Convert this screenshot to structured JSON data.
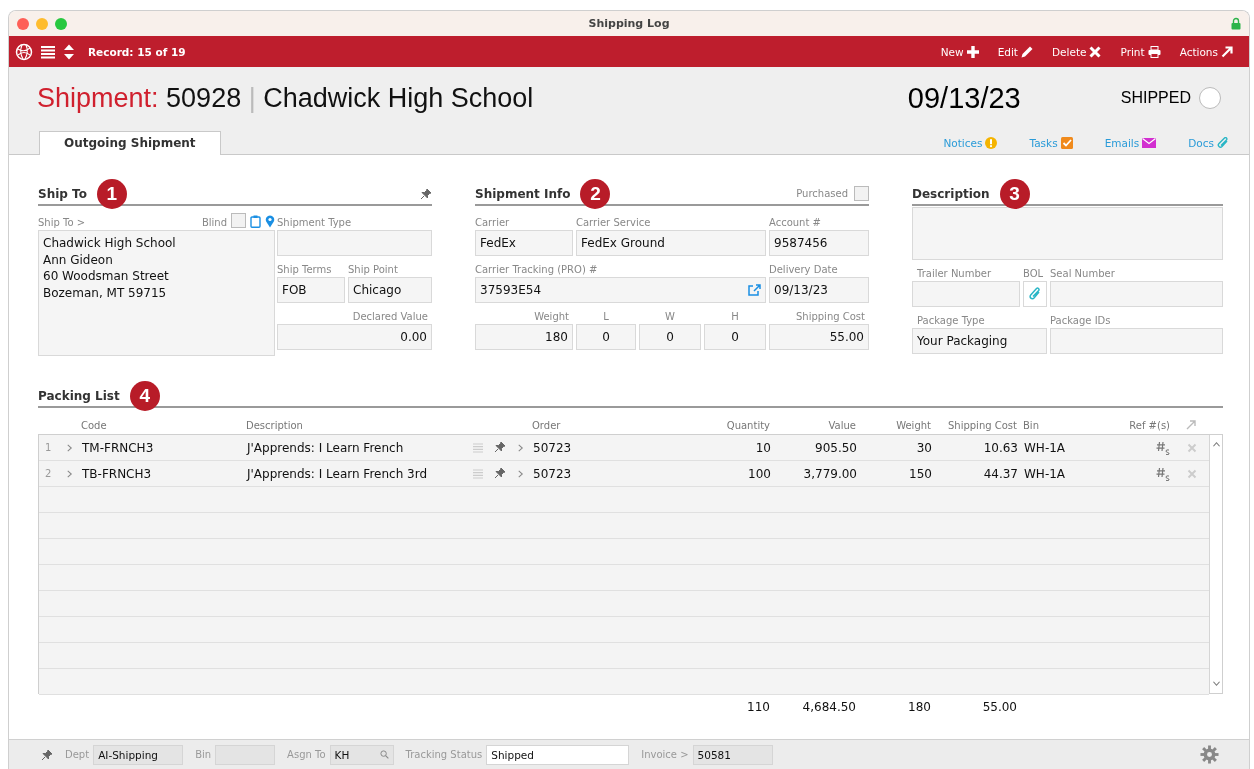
{
  "window": {
    "title": "Shipping Log"
  },
  "toolbar": {
    "record": "Record: 15 of 19",
    "actions": [
      {
        "label": "New",
        "kind": "new"
      },
      {
        "label": "Edit",
        "kind": "edit"
      },
      {
        "label": "Delete",
        "kind": "delete"
      },
      {
        "label": "Print",
        "kind": "print"
      },
      {
        "label": "Actions",
        "kind": "actions"
      }
    ]
  },
  "header": {
    "prefix": "Shipment:",
    "number": "50928",
    "separator": "|",
    "name": "Chadwick High School",
    "date": "09/13/23",
    "status": {
      "label": "SHIPPED",
      "checked": false
    }
  },
  "tabs": [
    {
      "label": "Outgoing Shipment",
      "selected": true
    }
  ],
  "links": [
    {
      "label": "Notices",
      "kind": "notices"
    },
    {
      "label": "Tasks",
      "kind": "tasks"
    },
    {
      "label": "Emails",
      "kind": "emails"
    },
    {
      "label": "Docs",
      "kind": "docs"
    }
  ],
  "ship_to": {
    "title": "Ship To",
    "badge": "1",
    "link": "Ship To >",
    "blind": {
      "label": "Blind",
      "checked": false
    },
    "address_lines": [
      "Chadwick High School",
      "Ann Gideon",
      "60 Woodsman Street",
      "Bozeman, MT 59715"
    ],
    "shipment_type": {
      "label": "Shipment Type"
    },
    "ship_terms": {
      "label": "Ship Terms",
      "value": "FOB"
    },
    "ship_point": {
      "label": "Ship Point",
      "value": "Chicago"
    },
    "declared_value": {
      "label": "Declared Value",
      "value": "0.00"
    }
  },
  "shipment_info": {
    "title": "Shipment Info",
    "badge": "2",
    "purchased": {
      "label": "Purchased",
      "checked": false
    },
    "carrier": {
      "label": "Carrier",
      "value": "FedEx"
    },
    "carrier_service": {
      "label": "Carrier Service",
      "value": "FedEx Ground"
    },
    "account": {
      "label": "Account #",
      "value": "9587456"
    },
    "tracking": {
      "label": "Carrier Tracking (PRO) #",
      "value": "37593E54"
    },
    "delivery_date": {
      "label": "Delivery Date",
      "value": "09/13/23"
    },
    "weight": {
      "label": "Weight",
      "value": "180"
    },
    "length": {
      "label": "L",
      "value": "0"
    },
    "width": {
      "label": "W",
      "value": "0"
    },
    "height": {
      "label": "H",
      "value": "0"
    },
    "shipping_cost": {
      "label": "Shipping Cost",
      "value": "55.00"
    }
  },
  "description": {
    "title": "Description",
    "badge": "3",
    "trailer_number": {
      "label": "Trailer Number"
    },
    "bol": {
      "label": "BOL"
    },
    "seal_number": {
      "label": "Seal Number"
    },
    "package_type": {
      "label": "Package Type",
      "value": "Your Packaging"
    },
    "package_ids": {
      "label": "Package IDs"
    }
  },
  "packing_list": {
    "title": "Packing List",
    "badge": "4",
    "columns": [
      {
        "label": "Code"
      },
      {
        "label": "Description"
      },
      {
        "label": "Order"
      },
      {
        "label": "Quantity"
      },
      {
        "label": "Value"
      },
      {
        "label": "Weight"
      },
      {
        "label": "Shipping Cost"
      },
      {
        "label": "Bin"
      },
      {
        "label": "Ref #(s)"
      }
    ],
    "rows": [
      {
        "number": "1",
        "code": "TM-FRNCH3",
        "description": "J'Apprends: I Learn French",
        "order": "50723",
        "quantity": "10",
        "value": "905.50",
        "weight": "30",
        "shipping_cost": "10.63",
        "bin": "WH-1A"
      },
      {
        "number": "2",
        "code": "TB-FRNCH3",
        "description": "J'Apprends: I Learn French 3rd",
        "order": "50723",
        "quantity": "100",
        "value": "3,779.00",
        "weight": "150",
        "shipping_cost": "44.37",
        "bin": "WH-1A"
      }
    ],
    "totals": {
      "quantity": "110",
      "value": "4,684.50",
      "weight": "180",
      "shipping_cost": "55.00"
    }
  },
  "status_bar": {
    "fields": [
      {
        "label": "Dept",
        "value": "AI-Shipping",
        "kind": "field"
      },
      {
        "label": "Bin",
        "kind": "field"
      },
      {
        "label": "Asgn To",
        "value": "KH",
        "kind": "search"
      },
      {
        "label": "Tracking Status",
        "value": "Shipped",
        "kind": "entry"
      },
      {
        "label": "Invoice >",
        "value": "50581",
        "kind": "linked"
      }
    ]
  }
}
